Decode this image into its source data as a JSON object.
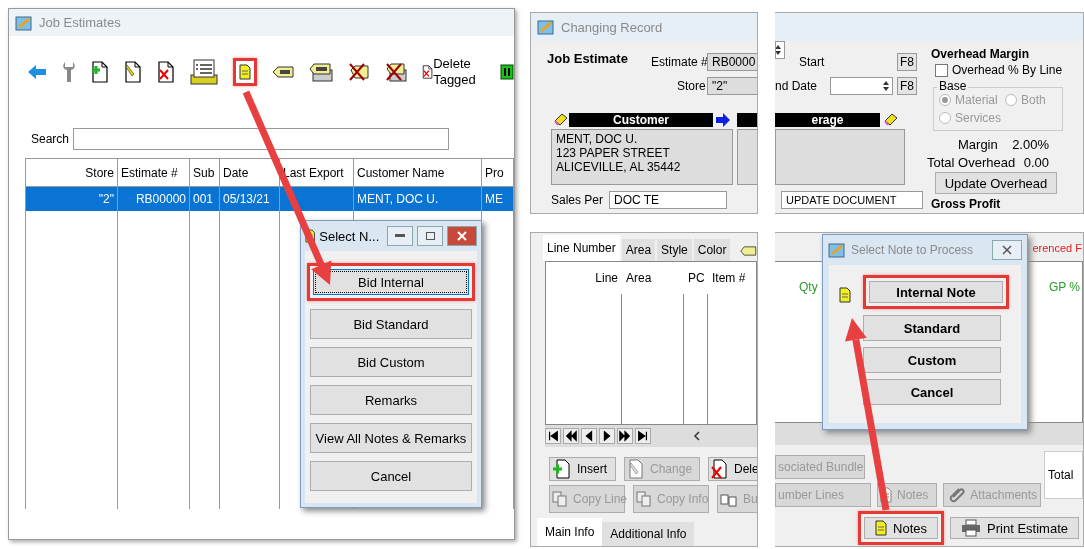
{
  "job_estimates": {
    "title": "Job Estimates",
    "toolbar": [
      {
        "kind": "back",
        "highlighted": false
      },
      {
        "kind": "wrench",
        "highlighted": false
      },
      {
        "kind": "add",
        "highlighted": false
      },
      {
        "kind": "edit",
        "highlighted": false
      },
      {
        "kind": "delete",
        "highlighted": false
      },
      {
        "kind": "list",
        "highlighted": false
      },
      {
        "kind": "note",
        "highlighted": true
      },
      {
        "kind": "tag",
        "highlighted": false
      },
      {
        "kind": "tags",
        "highlighted": false
      },
      {
        "kind": "tag_delete",
        "highlighted": false
      },
      {
        "kind": "tags_delete",
        "highlighted": false
      },
      {
        "kind": "delete_label",
        "label": "Delete Tagged",
        "highlighted": false
      },
      {
        "kind": "panel",
        "highlighted": false
      }
    ],
    "search": {
      "label": "Search"
    },
    "table": {
      "columns": [
        "Store",
        "Estimate #",
        "Sub",
        "Date",
        "Last Export",
        "Customer Name",
        "Pro"
      ],
      "rows": [
        {
          "selected": true,
          "cells": [
            "\"2\"",
            "RB00000",
            "001",
            "05/13/21",
            null,
            "MENT, DOC U.",
            "ME"
          ]
        }
      ]
    }
  },
  "select_note_dialog_left": {
    "title": "Select N...",
    "buttons": [
      {
        "label": "Bid Internal",
        "highlighted": true,
        "focused": true
      },
      {
        "label": "Bid Standard",
        "highlighted": false,
        "focused": false
      },
      {
        "label": "Bid Custom",
        "highlighted": false,
        "focused": false
      },
      {
        "label": "Remarks",
        "highlighted": false,
        "focused": false
      },
      {
        "label": "View All Notes & Remarks",
        "highlighted": false,
        "focused": false
      },
      {
        "label": "Cancel",
        "highlighted": false,
        "focused": false
      }
    ]
  },
  "changing_record": {
    "title": "Changing Record",
    "heading": "Job Estimate",
    "estimate": {
      "label": "Estimate #",
      "value": "RB0000"
    },
    "store": {
      "label": "Store",
      "value": "\"2\""
    },
    "start": {
      "label": "Start",
      "button": "F8"
    },
    "end_date": {
      "label": "nd Date",
      "button": "F8"
    },
    "customer": {
      "header": "Customer",
      "lines": [
        "MENT, DOC U.",
        "123 PAPER STREET",
        "ALICEVILLE, AL 35442"
      ]
    },
    "second_header": "erage",
    "sales": {
      "label": "Sales Per",
      "value": "DOC TE"
    },
    "document_field": "UPDATE DOCUMENT",
    "overhead": {
      "title": "Overhead Margin",
      "by_line": {
        "label": "Overhead % By Line",
        "checked": false
      },
      "base": {
        "label": "Base",
        "disabled": true,
        "options": [
          {
            "label": "Material",
            "selected": true
          },
          {
            "label": "Both",
            "selected": false
          },
          {
            "label": "Services",
            "selected": false
          }
        ]
      },
      "margin": {
        "label": "Margin",
        "value": "2.00%"
      },
      "total": {
        "label": "Total Overhead",
        "value": "0.00"
      },
      "update_button": "Update Overhead"
    },
    "gross_profit": "Gross Profit",
    "line_tabs": [
      {
        "label": "Line Number",
        "selected": true
      },
      {
        "label": "Area",
        "selected": false
      },
      {
        "label": "Style",
        "selected": false
      },
      {
        "label": "Color",
        "selected": false
      }
    ],
    "grid_columns": [
      "Line",
      "Area",
      "PC",
      "Item #"
    ],
    "right_columns": [
      "Qty",
      "GP %"
    ],
    "referenced_label": "erenced F",
    "actions": [
      {
        "label": "Insert",
        "disabled": false
      },
      {
        "label": "Change",
        "disabled": true
      },
      {
        "label": "Dele",
        "disabled": false
      }
    ],
    "actions_row2": [
      {
        "label": "Copy Line",
        "disabled": true
      },
      {
        "label": "Copy Info",
        "disabled": true
      },
      {
        "label": "Bu",
        "disabled": true
      }
    ],
    "right_actions": [
      {
        "label": "sociated Bundle",
        "disabled": true
      }
    ],
    "right_actions_row2": [
      {
        "label": "umber Lines",
        "disabled": true
      },
      {
        "label": "Notes",
        "disabled": true
      },
      {
        "label": "Attachments",
        "disabled": true
      }
    ],
    "total_label": "Total",
    "bottom_tabs": [
      {
        "label": "Main Info",
        "selected": true
      },
      {
        "label": "Additional Info",
        "selected": false
      }
    ],
    "footer_buttons": [
      {
        "label": "Notes",
        "highlighted": true
      },
      {
        "label": "Print Estimate",
        "highlighted": false
      }
    ]
  },
  "select_note_dialog_right": {
    "title": "Select Note to Process",
    "buttons": [
      {
        "label": "Internal Note",
        "highlighted": true
      },
      {
        "label": "Standard",
        "highlighted": false
      },
      {
        "label": "Custom",
        "highlighted": false
      },
      {
        "label": "Cancel",
        "highlighted": false
      }
    ]
  }
}
